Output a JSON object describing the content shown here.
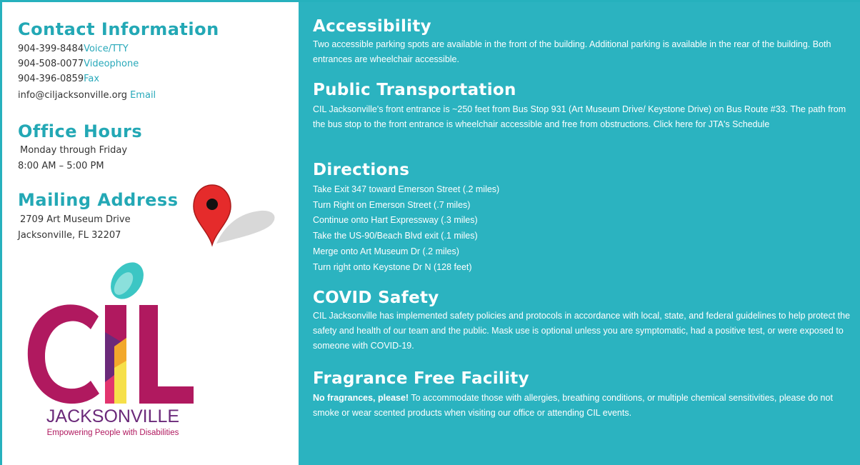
{
  "contact": {
    "heading": "Contact Information",
    "lines": [
      {
        "value": "904-399-8484",
        "tag": "Voice/TTY"
      },
      {
        "value": "904-508-0077",
        "tag": "Videophone"
      },
      {
        "value": "904-396-0859",
        "tag": "Fax"
      },
      {
        "value": "info@ciljacksonville.org",
        "tag": "Email"
      }
    ]
  },
  "office_hours": {
    "heading": "Office Hours",
    "days": "Monday through Friday",
    "hours": "8:00 AM – 5:00 PM"
  },
  "mailing": {
    "heading": "Mailing Address",
    "street": "2709 Art Museum Drive",
    "city": "Jacksonville, FL 32207"
  },
  "logo": {
    "letters": "CIL",
    "name": "JACKSONVILLE",
    "tagline": "Empowering People with Disabilities"
  },
  "accessibility": {
    "heading": "Accessibility",
    "body": "Two accessible parking spots are available in the front of the building. Additional parking is available in the rear of the building. Both entrances are wheelchair accessible."
  },
  "transport": {
    "heading": "Public Transportation",
    "body": "CIL Jacksonville's front entrance is ~250 feet from Bus Stop 931 (Art Museum Drive/ Keystone Drive) on Bus Route #33. The path from the bus stop to the front entrance is wheelchair accessible and free from obstructions. Click here for JTA's Schedule"
  },
  "directions": {
    "heading": "Directions",
    "steps": [
      "Take Exit 347 toward Emerson Street (.2 miles)",
      "Turn Right on Emerson Street (.7 miles)",
      "Continue onto Hart Expressway (.3 miles)",
      "Take the US-90/Beach Blvd exit (.1 miles)",
      "Merge onto Art Museum Dr (.2 miles)",
      "Turn right onto Keystone Dr N (128 feet)"
    ]
  },
  "covid": {
    "heading": "COVID Safety",
    "body": "CIL Jacksonville has implemented safety policies and protocols in accordance with local, state, and federal guidelines to help protect the safety and health of our team and the public. Mask use is optional unless you are symptomatic, had a positive test, or were exposed to someone with COVID-19."
  },
  "fragrance": {
    "heading": "Fragrance Free Facility",
    "bold": "No fragrances, please!",
    "body": " To accommodate those with allergies, breathing conditions, or multiple chemical sensitivities, please do not smoke or wear scented products when visiting our office or attending CIL events."
  },
  "colors": {
    "teal_panel": "#2bb3c0",
    "teal_heading": "#23a8b5",
    "magenta": "#b0195f",
    "purple": "#6b2a7a",
    "pin_red": "#e52b2b"
  },
  "icons": {
    "map_pin": "map-pin-icon"
  }
}
